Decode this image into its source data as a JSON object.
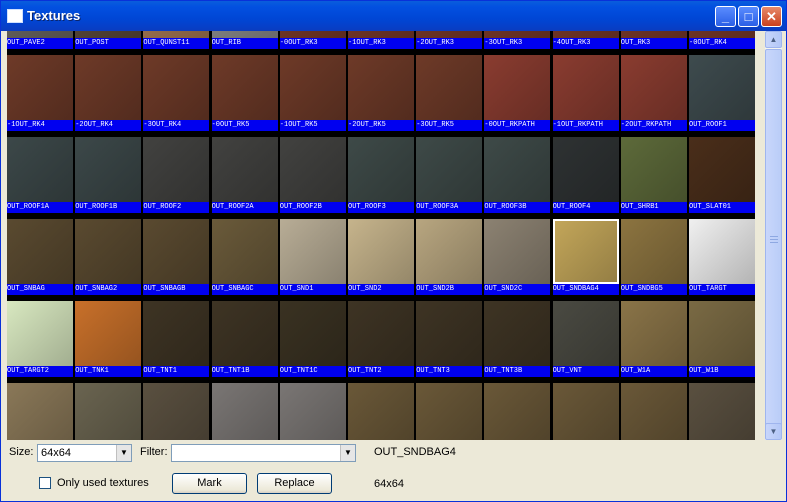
{
  "window": {
    "title": "Textures"
  },
  "titlebar_buttons": {
    "minimize": "_",
    "maximize": "□",
    "close": "✕"
  },
  "textures": [
    {
      "label": "OUT_PAVE2",
      "color": "#6c6862"
    },
    {
      "label": "OUT_POST",
      "color": "#5c4a3a"
    },
    {
      "label": "OUT_QUNST11",
      "color": "#a87a55"
    },
    {
      "label": "OUT_RIB",
      "color": "#8d8d8d"
    },
    {
      "label": "-0OUT_RK3",
      "color": "#7a3a2a"
    },
    {
      "label": "-1OUT_RK3",
      "color": "#7a3a2a"
    },
    {
      "label": "-2OUT_RK3",
      "color": "#7a3a2a"
    },
    {
      "label": "-3OUT_RK3",
      "color": "#7a3a2a"
    },
    {
      "label": "-4OUT_RK3",
      "color": "#7a3a2a"
    },
    {
      "label": "OUT_RK3",
      "color": "#7a3a2a"
    },
    {
      "label": "-0OUT_RK4",
      "color": "#7a3a2a"
    },
    {
      "label": "-1OUT_RK4",
      "color": "#6e3a28"
    },
    {
      "label": "-2OUT_RK4",
      "color": "#6e3a28"
    },
    {
      "label": "-3OUT_RK4",
      "color": "#6e3a28"
    },
    {
      "label": "-0OUT_RK5",
      "color": "#6e3a28"
    },
    {
      "label": "-1OUT_RK5",
      "color": "#6e3a28"
    },
    {
      "label": "-2OUT_RK5",
      "color": "#6e3a28"
    },
    {
      "label": "-3OUT_RK5",
      "color": "#6e3a28"
    },
    {
      "label": "-0OUT_RKPATH",
      "color": "#8a3c30"
    },
    {
      "label": "-1OUT_RKPATH",
      "color": "#8a3c30"
    },
    {
      "label": "-2OUT_RKPATH",
      "color": "#8a3c30"
    },
    {
      "label": "OUT_ROOF1",
      "color": "#3e4b4e"
    },
    {
      "label": "OUT_ROOF1A",
      "color": "#3c4849"
    },
    {
      "label": "OUT_ROOF1B",
      "color": "#3c4849"
    },
    {
      "label": "OUT_ROOF2",
      "color": "#424240"
    },
    {
      "label": "OUT_ROOF2A",
      "color": "#424240"
    },
    {
      "label": "OUT_ROOF2B",
      "color": "#424240"
    },
    {
      "label": "OUT_ROOF3",
      "color": "#3e4a48"
    },
    {
      "label": "OUT_ROOF3A",
      "color": "#3e4a48"
    },
    {
      "label": "OUT_ROOF3B",
      "color": "#3e4a48"
    },
    {
      "label": "OUT_ROOF4",
      "color": "#2e3233"
    },
    {
      "label": "OUT_SHRB1",
      "color": "#5d6a3a"
    },
    {
      "label": "OUT_SLAT01",
      "color": "#4a2e1a"
    },
    {
      "label": "OUT_SNBAG",
      "color": "#5a4a30"
    },
    {
      "label": "OUT_SNBAG2",
      "color": "#5a4a30"
    },
    {
      "label": "OUT_SNBAGB",
      "color": "#5a4a30"
    },
    {
      "label": "OUT_SNBAGC",
      "color": "#6a5a3a"
    },
    {
      "label": "OUT_SND1",
      "color": "#b8ad96"
    },
    {
      "label": "OUT_SND2",
      "color": "#c6b48c"
    },
    {
      "label": "OUT_SND2B",
      "color": "#b8a680"
    },
    {
      "label": "OUT_SND2C",
      "color": "#8c8272"
    },
    {
      "label": "OUT_SNDBAG4",
      "color": "#c4a75a"
    },
    {
      "label": "OUT_SNDBG5",
      "color": "#8c7440"
    },
    {
      "label": "OUT_TARGT",
      "color": "#f0f0f0"
    },
    {
      "label": "OUT_TARGT2",
      "color": "#d8e8c0"
    },
    {
      "label": "OUT_TNK1",
      "color": "#c8702a"
    },
    {
      "label": "OUT_TNT1",
      "color": "#3e3424"
    },
    {
      "label": "OUT_TNT1B",
      "color": "#3e3424"
    },
    {
      "label": "OUT_TNT1C",
      "color": "#3a3222"
    },
    {
      "label": "OUT_TNT2",
      "color": "#3e3424"
    },
    {
      "label": "OUT_TNT3",
      "color": "#3e3424"
    },
    {
      "label": "OUT_TNT3B",
      "color": "#3e3424"
    },
    {
      "label": "OUT_VNT",
      "color": "#4a4a42"
    },
    {
      "label": "OUT_W1A",
      "color": "#8a7448"
    },
    {
      "label": "OUT_W1B",
      "color": "#7a6a44"
    },
    {
      "label": "",
      "color": "#8a7858"
    },
    {
      "label": "",
      "color": "#6a6450"
    },
    {
      "label": "",
      "color": "#5a5040"
    },
    {
      "label": "",
      "color": "#7a7674"
    },
    {
      "label": "",
      "color": "#7a7674"
    },
    {
      "label": "",
      "color": "#6a5838"
    },
    {
      "label": "",
      "color": "#6a5838"
    },
    {
      "label": "",
      "color": "#6a5838"
    },
    {
      "label": "",
      "color": "#6a5838"
    },
    {
      "label": "",
      "color": "#6a5838"
    },
    {
      "label": "",
      "color": "#5a5040"
    }
  ],
  "selected_index": 41,
  "controls": {
    "size_label": "Size:",
    "size_value": "64x64",
    "filter_label": "Filter:",
    "filter_value": "",
    "selected_name": "OUT_SNDBAG4",
    "selected_size": "64x64",
    "only_used_label": "Only used textures",
    "mark_label": "Mark",
    "replace_label": "Replace"
  },
  "scroll_arrows": {
    "up": "▲",
    "down": "▼"
  },
  "combo_arrow": "▼"
}
